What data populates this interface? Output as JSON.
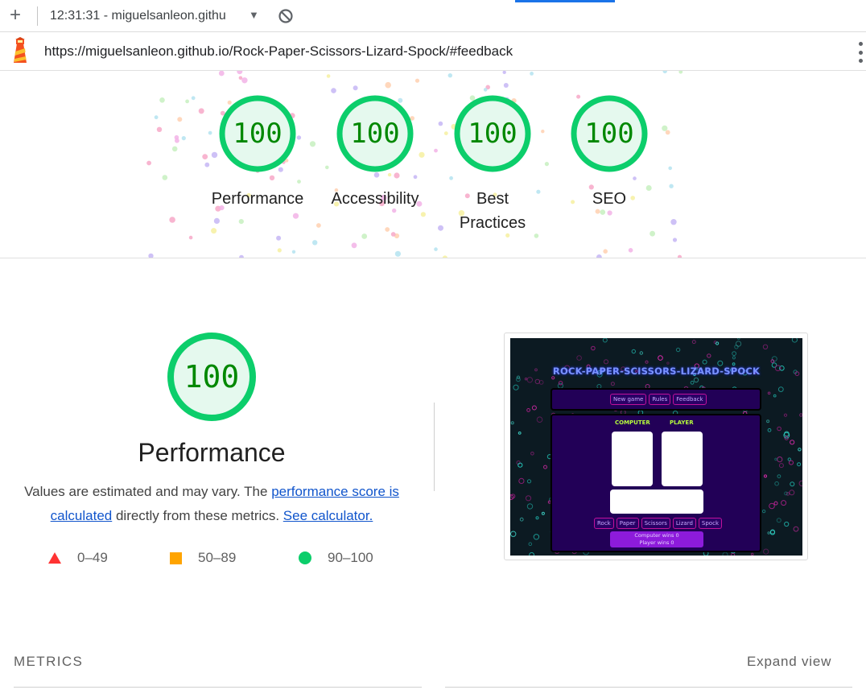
{
  "browser": {
    "tab_title": "12:31:31 - miguelsanleon.githu",
    "url": "https://miguelsanleon.github.io/Rock-Paper-Scissors-Lizard-Spock/#feedback",
    "accent_color": "#1a73e8"
  },
  "scores": [
    {
      "value": "100",
      "label": "Performance"
    },
    {
      "value": "100",
      "label": "Accessibility"
    },
    {
      "value": "100",
      "label": "Best Practices"
    },
    {
      "value": "100",
      "label": "SEO"
    }
  ],
  "score_colors": {
    "pass_ring": "#0cce6b",
    "pass_fill": "#e5f9ee",
    "pass_text": "#008800",
    "average": "#ffa400",
    "fail": "#ff3333"
  },
  "performance": {
    "score": "100",
    "title": "Performance",
    "desc_pre": "Values are estimated and may vary. The ",
    "link_score": "performance score is calculated",
    "desc_mid": " directly from these metrics. ",
    "link_calc": "See calculator."
  },
  "legend": [
    {
      "icon": "triangle-icon",
      "range": "0–49"
    },
    {
      "icon": "square-icon",
      "range": "50–89"
    },
    {
      "icon": "circle-icon",
      "range": "90–100"
    }
  ],
  "thumbnail": {
    "title": "ROCK-PAPER-SCISSORS-LIZARD-SPOCK",
    "nav": [
      "New game",
      "Rules",
      "Feedback"
    ],
    "computer_label": "COMPUTER",
    "player_label": "PLAYER",
    "choices": [
      "Rock",
      "Paper",
      "Scissors",
      "Lizard",
      "Spock"
    ],
    "computer_wins": "Computer wins 0",
    "player_wins": "Player wins 0"
  },
  "metrics": {
    "title": "METRICS",
    "expand": "Expand view"
  }
}
